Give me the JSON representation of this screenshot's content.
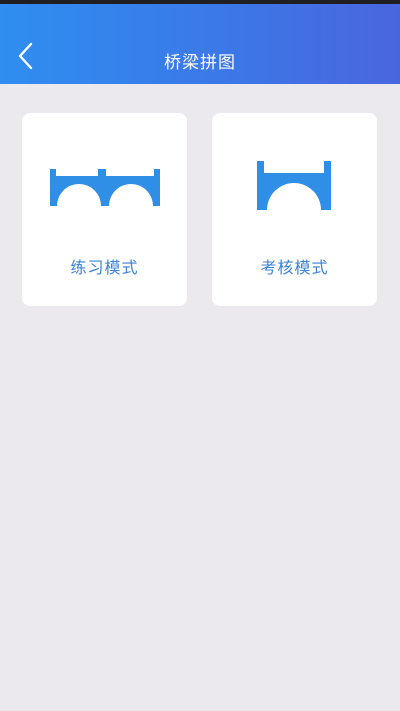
{
  "header": {
    "title": "桥梁拼图",
    "back_icon": "chevron-left-icon",
    "background_color": "#3b7be9"
  },
  "modes": [
    {
      "label": "练习模式",
      "icon": "double-arch-bridge-icon"
    },
    {
      "label": "考核模式",
      "icon": "single-arch-bridge-icon"
    }
  ],
  "colors": {
    "accent": "#2f8fe6",
    "label": "#3b83d6",
    "background": "#ebe9ee",
    "card": "#ffffff"
  }
}
